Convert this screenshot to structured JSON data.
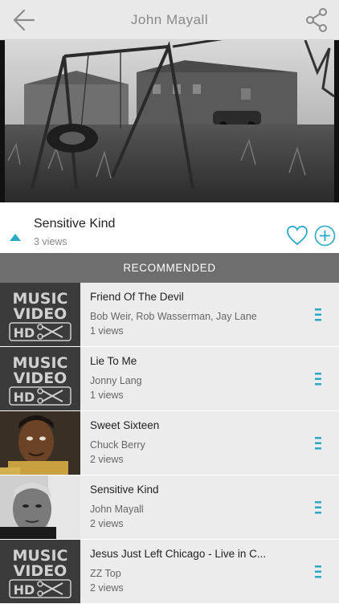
{
  "header": {
    "title": "John Mayall"
  },
  "now_playing": {
    "title": "Sensitive Kind",
    "views": "3 views"
  },
  "recommended": {
    "label": "RECOMMENDED",
    "items": [
      {
        "title": "Friend Of The Devil",
        "artist": "Bob Weir, Rob Wasserman, Jay Lane",
        "views": "1 views",
        "thumb": "music-video-hd"
      },
      {
        "title": "Lie To Me",
        "artist": "Jonny Lang",
        "views": "1 views",
        "thumb": "music-video-hd"
      },
      {
        "title": "Sweet Sixteen",
        "artist": "Chuck Berry",
        "views": "2 views",
        "thumb": "photo"
      },
      {
        "title": "Sensitive Kind",
        "artist": "John Mayall",
        "views": "2 views",
        "thumb": "photo"
      },
      {
        "title": "Jesus Just Left Chicago - Live in C...",
        "artist": "ZZ Top",
        "views": "2 views",
        "thumb": "music-video-hd"
      }
    ]
  },
  "colors": {
    "accent": "#29a9c4",
    "header_bg": "#6e6e6e"
  },
  "thumb_text": {
    "line1": "MUSIC",
    "line2": "VIDEO",
    "badge": "HD"
  }
}
